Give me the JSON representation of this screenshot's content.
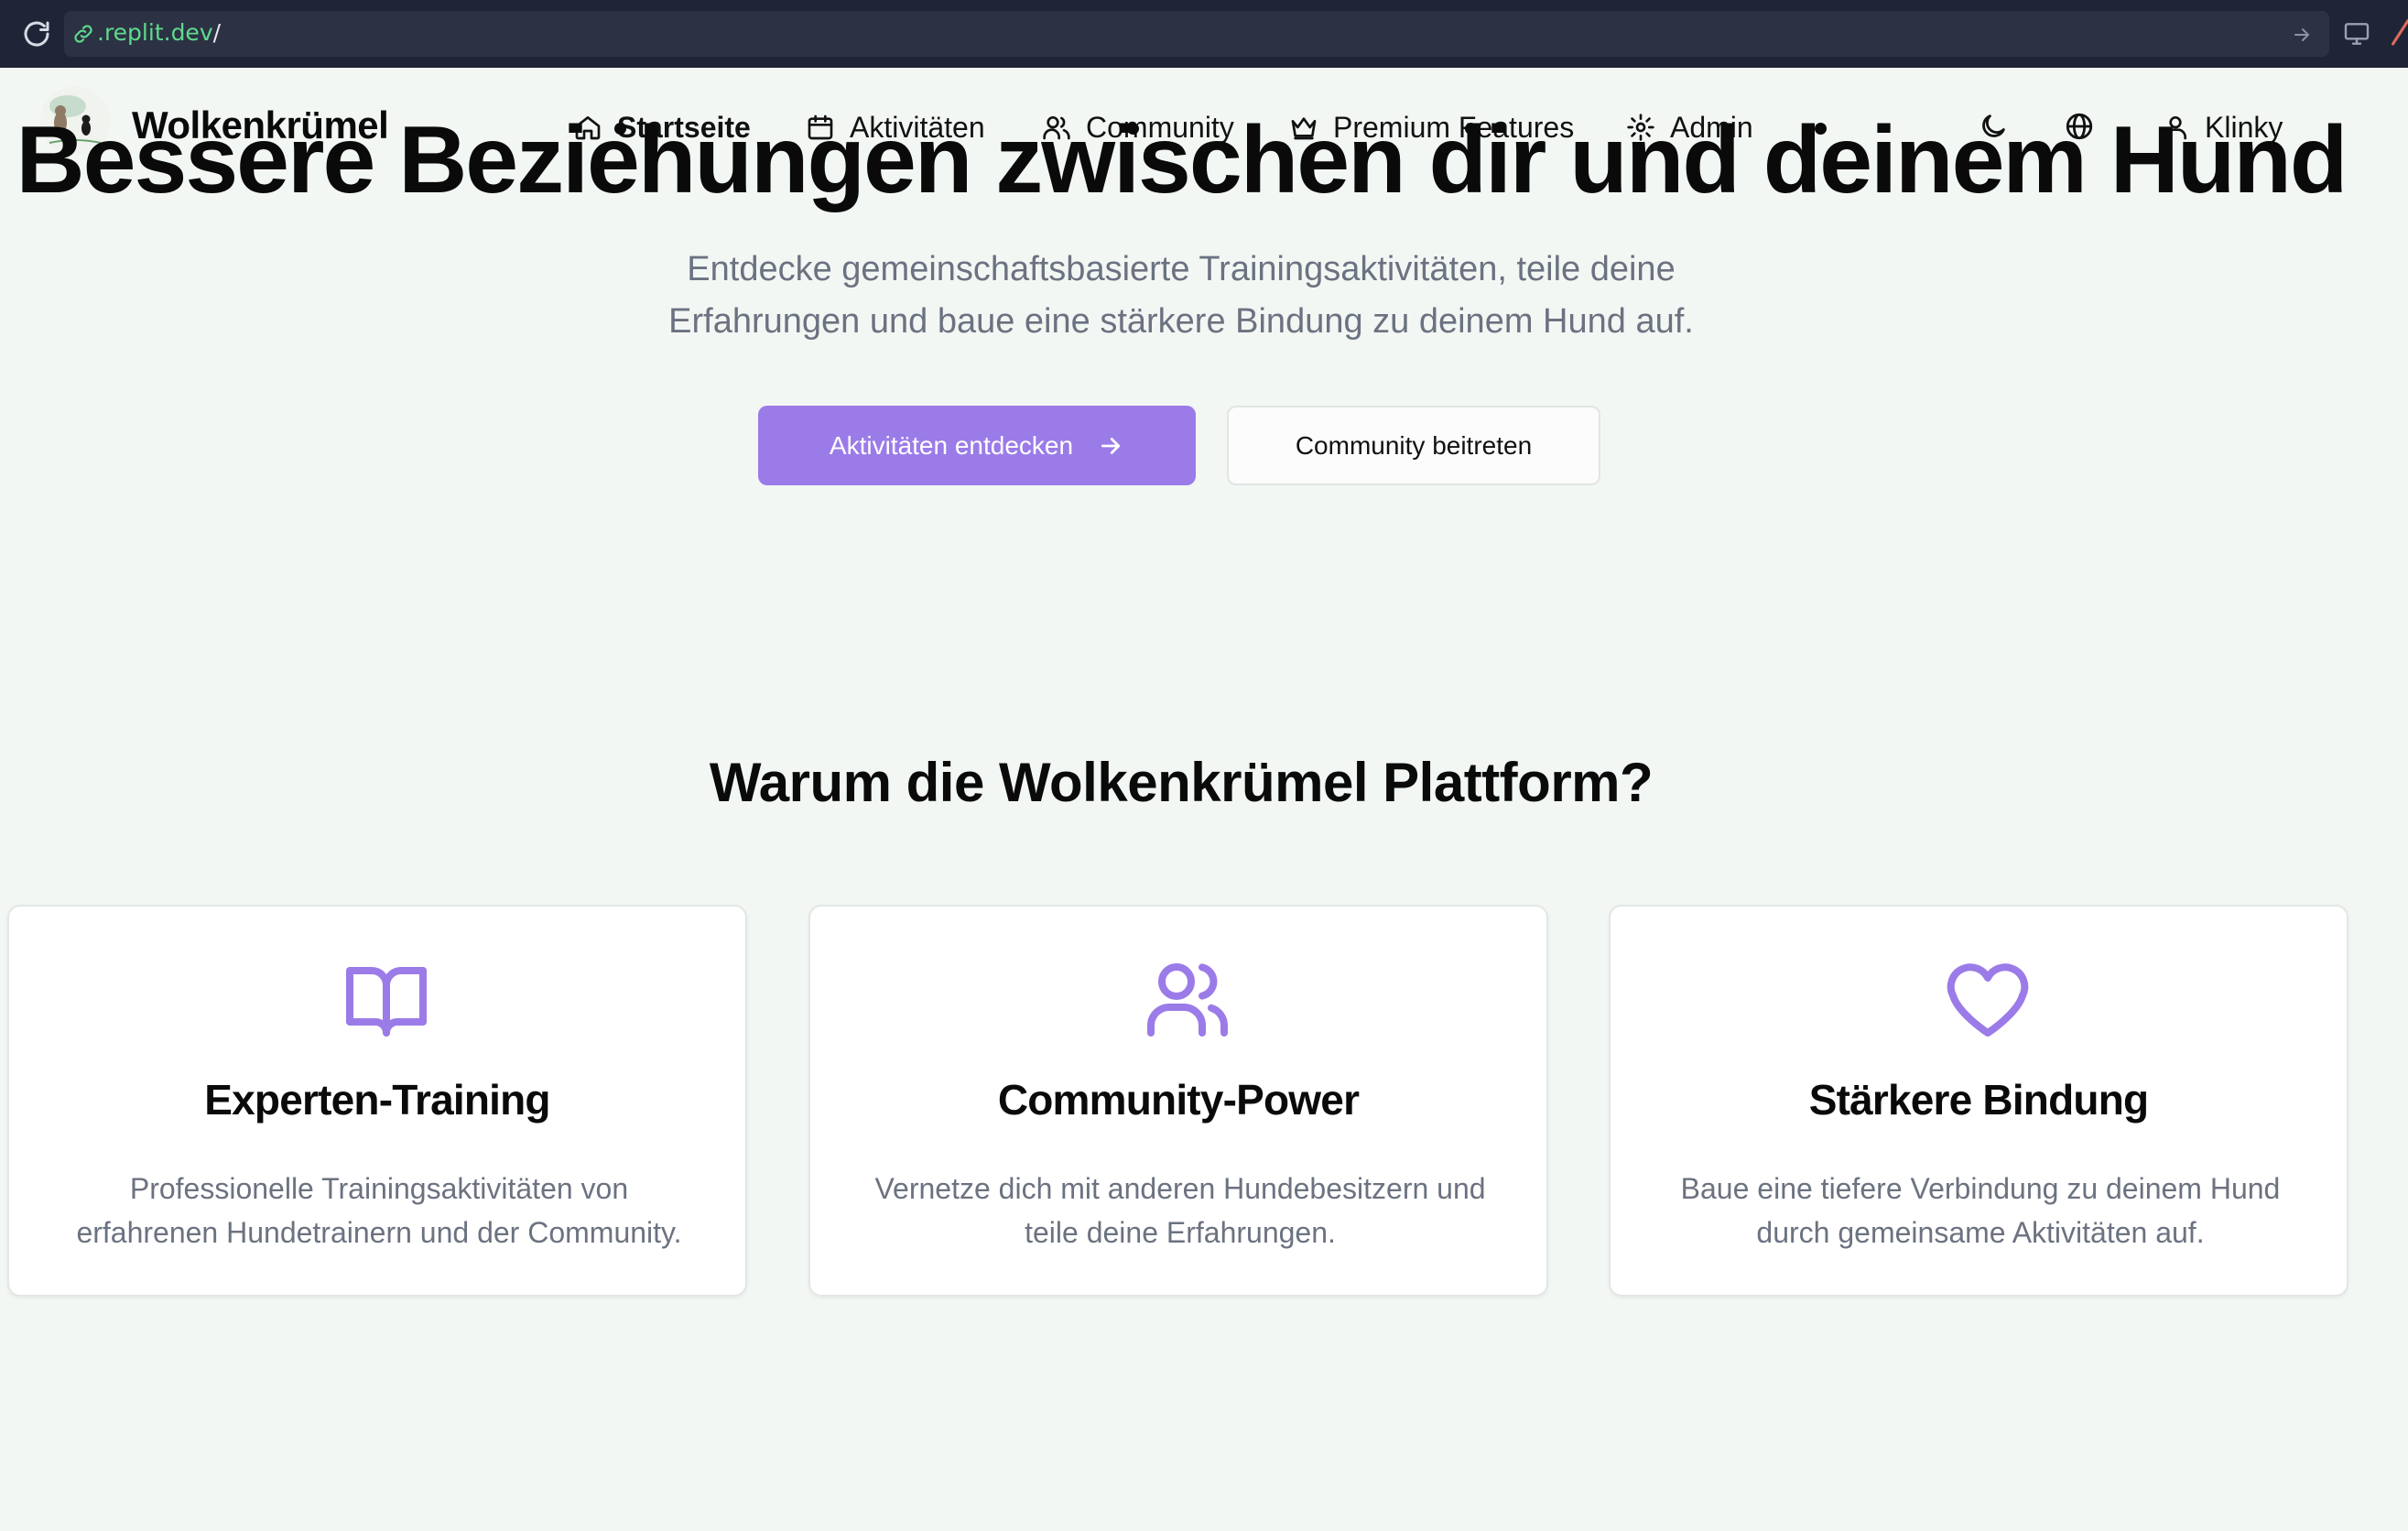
{
  "browser": {
    "url_host": ".replit.dev",
    "url_path": "/"
  },
  "nav": {
    "brand": "Wolkenkrümel",
    "items": [
      {
        "label": "Startseite",
        "icon": "home-icon",
        "active": true
      },
      {
        "label": "Aktivitäten",
        "icon": "calendar-icon"
      },
      {
        "label": "Community",
        "icon": "users-icon"
      },
      {
        "label": "Premium Features",
        "icon": "crown-icon"
      },
      {
        "label": "Admin",
        "icon": "gear-icon"
      }
    ],
    "user": "Klinky"
  },
  "hero": {
    "title": "Bessere Beziehungen zwischen dir und deinem Hund",
    "subtitle_line1": "Entdecke gemeinschaftsbasierte Trainingsaktivitäten, teile deine",
    "subtitle_line2": "Erfahrungen und baue eine stärkere Bindung zu deinem Hund auf.",
    "primary_button": "Aktivitäten entdecken",
    "secondary_button": "Community beitreten"
  },
  "features": {
    "title": "Warum die Wolkenkrümel Plattform?",
    "cards": [
      {
        "icon": "book-open-icon",
        "title": "Experten-Training",
        "line1": "Professionelle Trainingsaktivitäten von",
        "line2": "erfahrenen Hundetrainern und der Community."
      },
      {
        "icon": "users-icon",
        "title": "Community-Power",
        "line1": "Vernetze dich mit anderen Hundebesitzern und",
        "line2": "teile deine Erfahrungen."
      },
      {
        "icon": "heart-icon",
        "title": "Stärkere Bindung",
        "line1": "Baue eine tiefere Verbindung zu deinem Hund",
        "line2": "durch gemeinsame Aktivitäten auf."
      }
    ]
  },
  "colors": {
    "accent": "#9b7be8",
    "background": "#f3f7f4",
    "muted_text": "#6b7280",
    "url_green": "#5fd98e",
    "browser_bar": "#1f2536"
  }
}
